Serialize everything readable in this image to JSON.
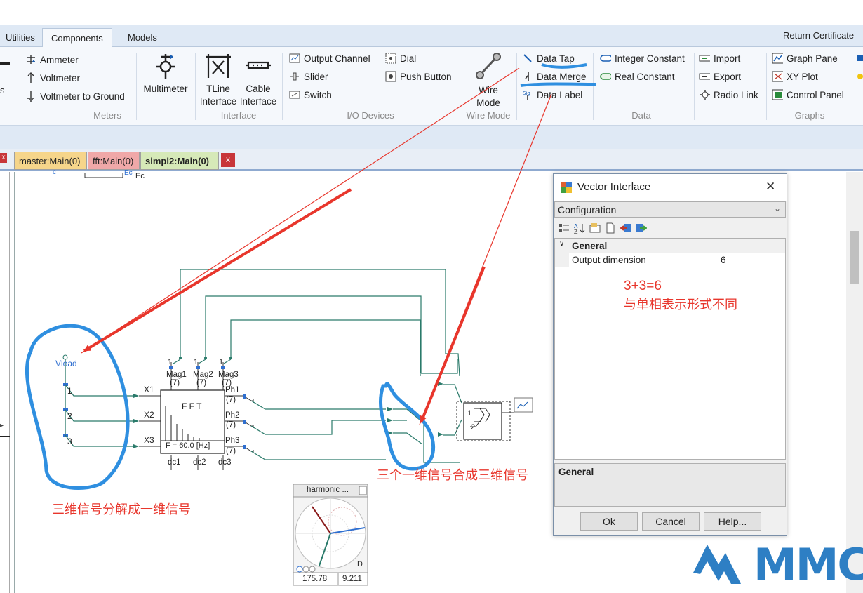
{
  "ribbon_tabs": [
    "Utilities",
    "Components",
    "Models"
  ],
  "return_certificate": "Return Certificate",
  "meters": {
    "items": [
      "Ammeter",
      "Voltmeter",
      "Voltmeter to Ground"
    ],
    "multimeter": "Multimeter",
    "label": "Meters"
  },
  "interface": {
    "tline": [
      "TLine",
      "Interface"
    ],
    "cable": [
      "Cable",
      "Interface"
    ],
    "label": "Interface"
  },
  "io_devices": {
    "items": [
      "Output Channel",
      "Slider",
      "Switch",
      "Dial",
      "Push Button"
    ],
    "label": "I/O Devices"
  },
  "wire_mode": {
    "button": [
      "Wire",
      "Mode"
    ],
    "label": "Wire Mode"
  },
  "data": {
    "items": [
      "Data Tap",
      "Data Merge",
      "Data Label",
      "Integer Constant",
      "Real Constant",
      "Import",
      "Export",
      "Radio Link"
    ],
    "label": "Data"
  },
  "graphs": {
    "items": [
      "Graph Pane",
      "XY Plot",
      "Control Panel"
    ],
    "label": "Graphs"
  },
  "doc_tabs": [
    "master:Main(0)",
    "fft:Main(0)",
    "simpl2:Main(0)"
  ],
  "doc_tab_close": "x",
  "left_close": "x",
  "schematic": {
    "top_labels": [
      "c",
      "Ec",
      "Ec"
    ],
    "vload": "Vload",
    "vload_pins": [
      "1",
      "2",
      "3"
    ],
    "fft_title": "F F T",
    "fft_freq": "F = 60.0 [Hz]",
    "fft_inputs": [
      "X1",
      "X2",
      "X3"
    ],
    "mag_outputs": [
      "Mag1",
      "Mag2",
      "Mag3"
    ],
    "ph_outputs": [
      "Ph1",
      "Ph2",
      "Ph3"
    ],
    "dc_outputs": [
      "dc1",
      "dc2",
      "dc3"
    ],
    "dim7": "(7)",
    "top_ones": [
      "1",
      "1",
      "1"
    ],
    "merge_pins": [
      "1",
      "2"
    ],
    "harmonic_title": "harmonic  ...",
    "harmonic_values": [
      "175.78",
      "9.211"
    ],
    "harmonic_d": "D"
  },
  "dialog": {
    "title": "Vector Interlace",
    "close": "✕",
    "combo": "Configuration",
    "category": "General",
    "property_name": "Output dimension",
    "property_value": "6",
    "desc_title": "General",
    "buttons": [
      "Ok",
      "Cancel",
      "Help..."
    ]
  },
  "annotations": {
    "formula": "3+3=6",
    "note": "与单相表示形式不同",
    "merge_note": "三个一维信号合成三维信号",
    "split_note": "三维信号分解成一维信号"
  },
  "logo": "MMC",
  "colors": {
    "wire": "#2a7a6a",
    "annotation": "#e8362c",
    "highlight": "#2f8fe0",
    "logo": "#2e7fc4"
  }
}
